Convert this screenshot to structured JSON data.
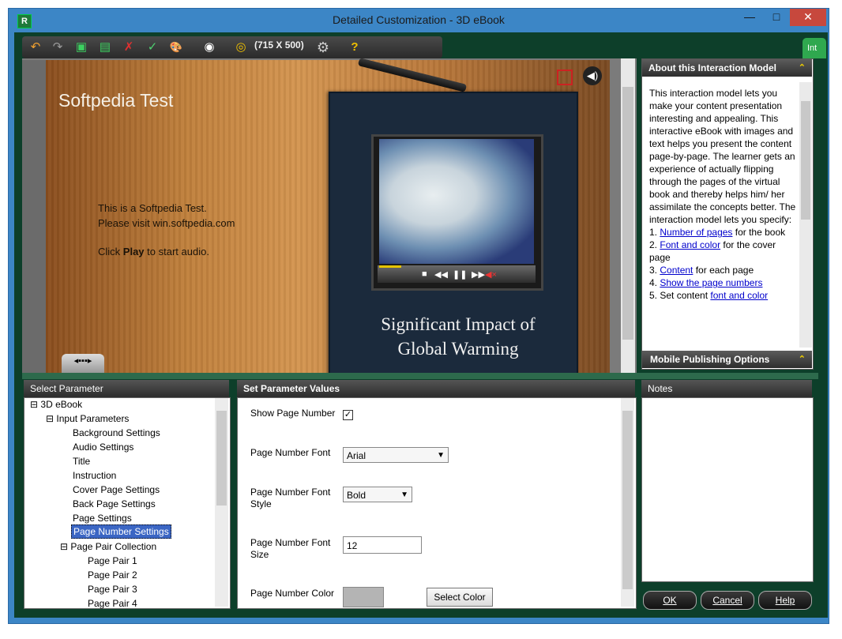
{
  "window": {
    "title": "Detailed Customization - 3D eBook",
    "app_icon": "R",
    "min_glyph": "—",
    "max_glyph": "□",
    "close_glyph": "✕"
  },
  "toolbar": {
    "resolution": "(715 X 500)",
    "right_tab": "Int",
    "icons": {
      "undo": "↶",
      "redo": "↷",
      "save": "▣",
      "save_all": "▤",
      "delete": "✗",
      "spell": "✓",
      "palette": "🎨",
      "preview": "◉",
      "publish": "◎",
      "settings": "⚙",
      "help": "?"
    }
  },
  "preview": {
    "stage_title": "Softpedia Test",
    "text_line1": "This is a Softpedia Test.",
    "text_line2": "Please visit win.softpedia.com",
    "click_prefix": "Click",
    "click_bold": "Play",
    "click_suffix": "to start audio.",
    "book_title_line1": "Significant Impact of",
    "book_title_line2": "Global Warming",
    "video_controls": [
      "■",
      "◀◀",
      "❚❚",
      "▶▶",
      "◀×"
    ],
    "speaker_glyph": "◀)",
    "nav_tab_glyph": "◂▪▪▪▸"
  },
  "about": {
    "heading": "About this Interaction Model",
    "chevron": "⌃",
    "body": "This interaction model lets you make your content presentation interesting and appealing. This interactive eBook with images and text helps you present the content page-by-page. The learner gets an experience of actually flipping through the pages of the virtual book and thereby helps him/ her assimilate the concepts better. The interaction model lets you specify:",
    "items": [
      {
        "num": "1.",
        "link": "Number of pages",
        "rest": " for the book"
      },
      {
        "num": "2.",
        "link": "Font and color",
        "rest": " for the cover page"
      },
      {
        "num": "3.",
        "link": "Content",
        "rest": " for each page"
      },
      {
        "num": "4.",
        "link": "Show the page numbers",
        "rest": ""
      },
      {
        "num": "5.",
        "link": "font and color",
        "pre": " Set content ",
        "rest": ""
      }
    ],
    "mobile_heading": "Mobile Publishing Options"
  },
  "select_parameter": {
    "heading": "Select Parameter",
    "tree": {
      "root": "3D eBook",
      "input": "Input Parameters",
      "items": [
        "Background Settings",
        "Audio Settings",
        "Title",
        "Instruction",
        "Cover Page Settings",
        "Back Page Settings",
        "Page Settings",
        "Page Number Settings"
      ],
      "collection": "Page Pair Collection",
      "pairs": [
        "Page Pair  1",
        "Page Pair  2",
        "Page Pair  3",
        "Page Pair  4"
      ]
    }
  },
  "set_values": {
    "heading": "Set Parameter Values",
    "show_page_number_label": "Show Page Number",
    "show_page_number_checked": "✓",
    "font_label": "Page Number Font",
    "font_value": "Arial",
    "style_label_1": "Page Number Font",
    "style_label_2": "Style",
    "style_value": "Bold",
    "size_label_1": "Page Number Font",
    "size_label_2": "Size",
    "size_value": "12",
    "color_label": "Page Number Color",
    "color_value": "#b4b4b4",
    "select_color_button": "Select Color"
  },
  "notes": {
    "heading": "Notes"
  },
  "dialog_buttons": {
    "ok": "OK",
    "cancel": "Cancel",
    "help": "Help"
  }
}
